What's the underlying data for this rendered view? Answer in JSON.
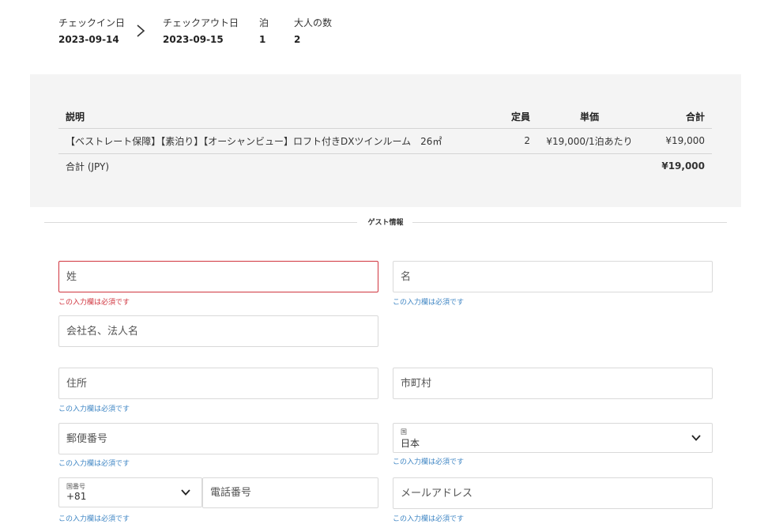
{
  "stay": {
    "checkin_label": "チェックイン日",
    "checkin_value": "2023-09-14",
    "checkout_label": "チェックアウト日",
    "checkout_value": "2023-09-15",
    "nights_label": "泊",
    "nights_value": "1",
    "adults_label": "大人の数",
    "adults_value": "2"
  },
  "price_table": {
    "headers": {
      "description": "説明",
      "capacity": "定員",
      "unit_price": "単価",
      "total": "合計"
    },
    "rows": [
      {
        "description": "【ベストレート保障】【素泊り】【オーシャンビュー】ロフト付きDXツインルーム　26㎡",
        "capacity": "2",
        "unit_price": "¥19,000/1泊あたり",
        "total": "¥19,000"
      }
    ],
    "grand_total_label": "合計 (JPY)",
    "grand_total_value": "¥19,000"
  },
  "guest_section": {
    "title": "ゲスト情報"
  },
  "form": {
    "last_name_placeholder": "姓",
    "first_name_placeholder": "名",
    "company_placeholder": "会社名、法人名",
    "address_placeholder": "住所",
    "city_placeholder": "市町村",
    "postal_code_placeholder": "郵便番号",
    "country_label": "国",
    "country_value": "日本",
    "country_code_label": "国番号",
    "country_code_value": "+81",
    "phone_placeholder": "電話番号",
    "email_placeholder": "メールアドレス",
    "required_message": "この入力欄は必須です"
  },
  "colors": {
    "error": "#d0353f",
    "helper": "#3f86c4",
    "panel_bg": "#f4f4f4"
  }
}
